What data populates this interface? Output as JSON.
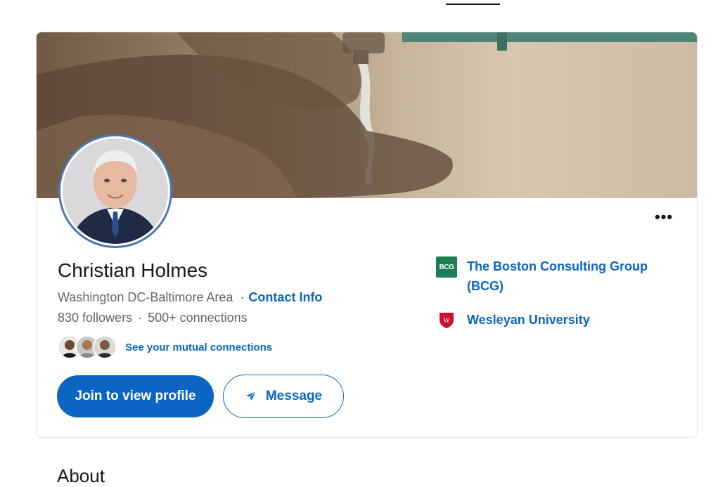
{
  "profile": {
    "name": "Christian Holmes",
    "location": "Washington DC-Baltimore Area",
    "contact_info_label": "Contact Info",
    "followers": "830 followers",
    "connections": "500+ connections",
    "mutual_connections_label": "See your mutual connections",
    "more_actions_label": "•••"
  },
  "actions": {
    "join_label": "Join to view profile",
    "message_label": "Message"
  },
  "experience": [
    {
      "name": "The Boston Consulting Group (BCG)",
      "logo_text": "BCG",
      "logo_color": "#1c7e52"
    },
    {
      "name": "Wesleyan University",
      "logo_text": "W",
      "logo_color": "#c8102e"
    }
  ],
  "sections": {
    "about_title": "About"
  },
  "colors": {
    "accent": "#0a66c2",
    "text_secondary": "#666666"
  },
  "icons": [
    "send-icon",
    "more-icon",
    "bcg-logo",
    "wesleyan-logo"
  ]
}
